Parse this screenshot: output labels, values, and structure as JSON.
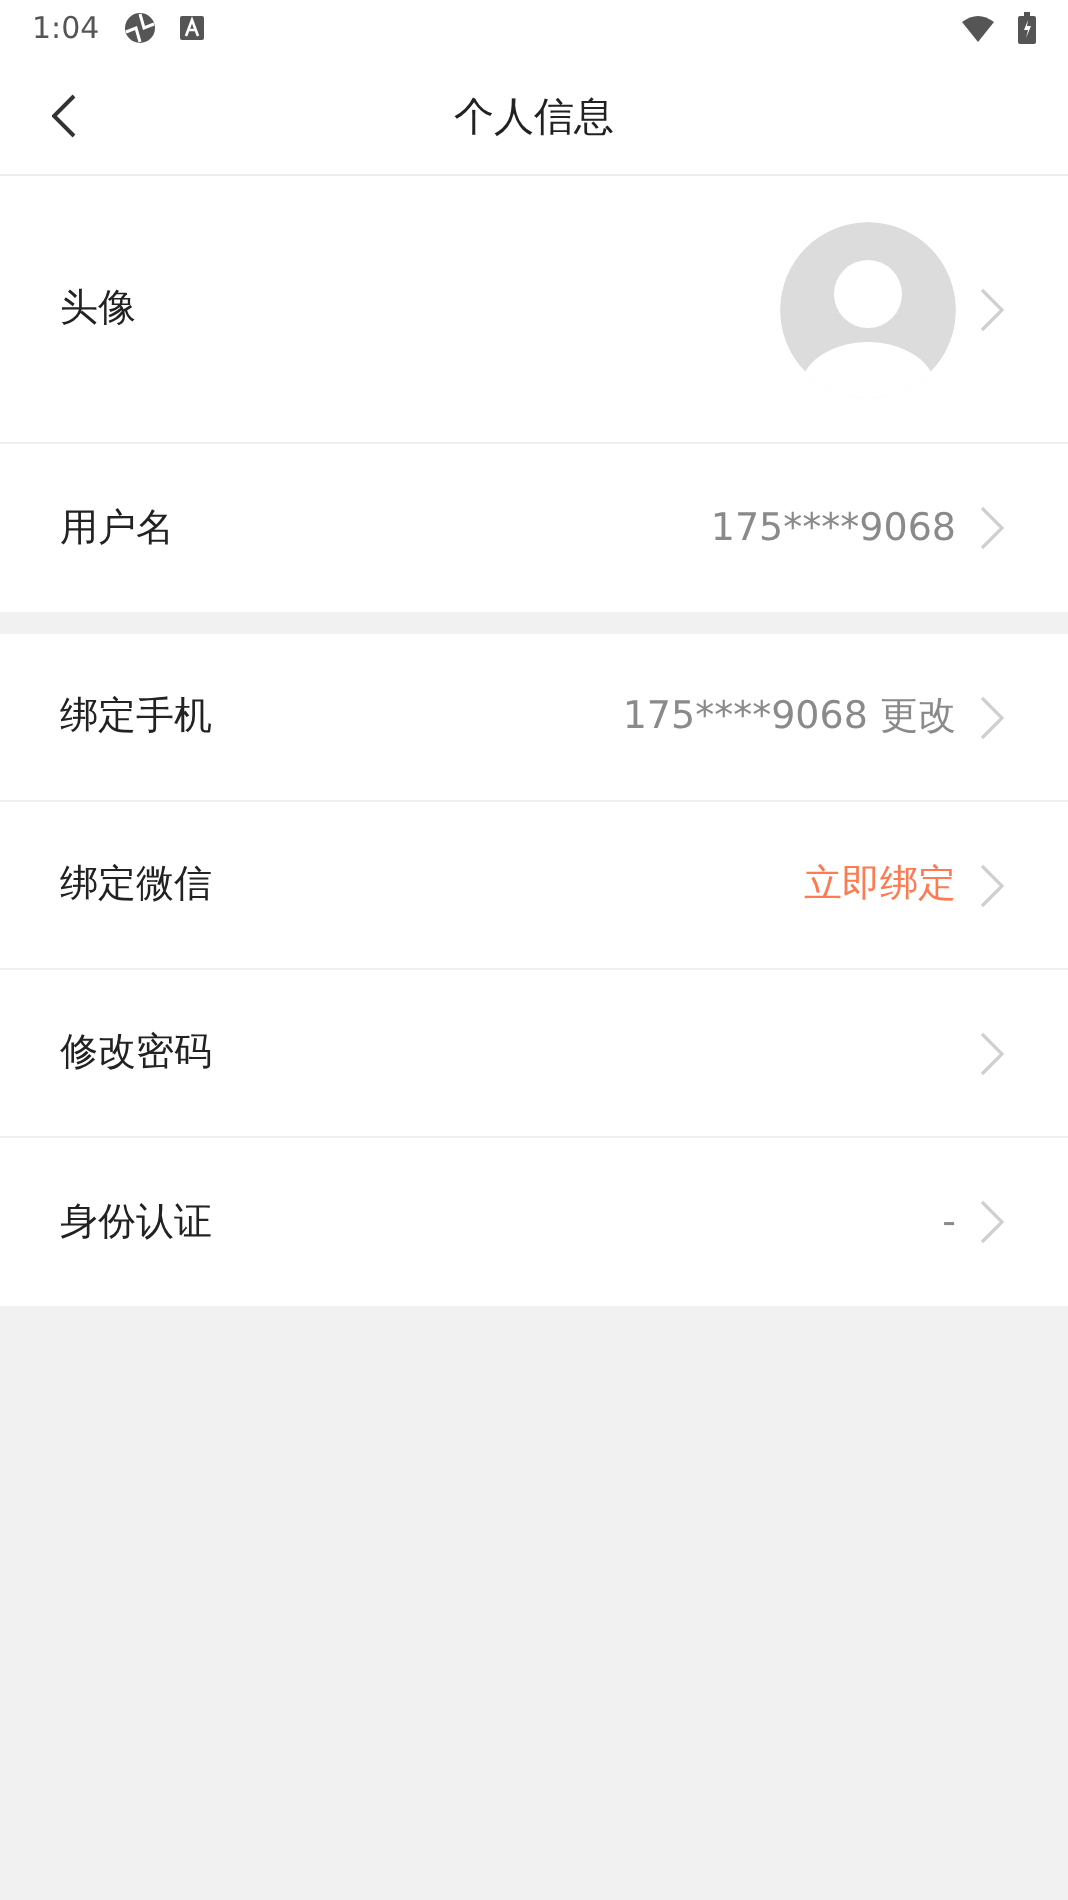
{
  "status_bar": {
    "time": "1:04"
  },
  "header": {
    "title": "个人信息"
  },
  "groups": [
    {
      "rows": [
        {
          "kind": "avatar",
          "label": "头像"
        },
        {
          "kind": "value",
          "label": "用户名",
          "value": "175****9068",
          "highlighted": false
        }
      ]
    },
    {
      "rows": [
        {
          "kind": "value",
          "label": "绑定手机",
          "value": "175****9068 更改",
          "highlighted": false
        },
        {
          "kind": "value",
          "label": "绑定微信",
          "value": "立即绑定",
          "highlighted": true
        },
        {
          "kind": "plain",
          "label": "修改密码"
        },
        {
          "kind": "value",
          "label": "身份认证",
          "value": "-",
          "highlighted": false
        }
      ]
    }
  ]
}
